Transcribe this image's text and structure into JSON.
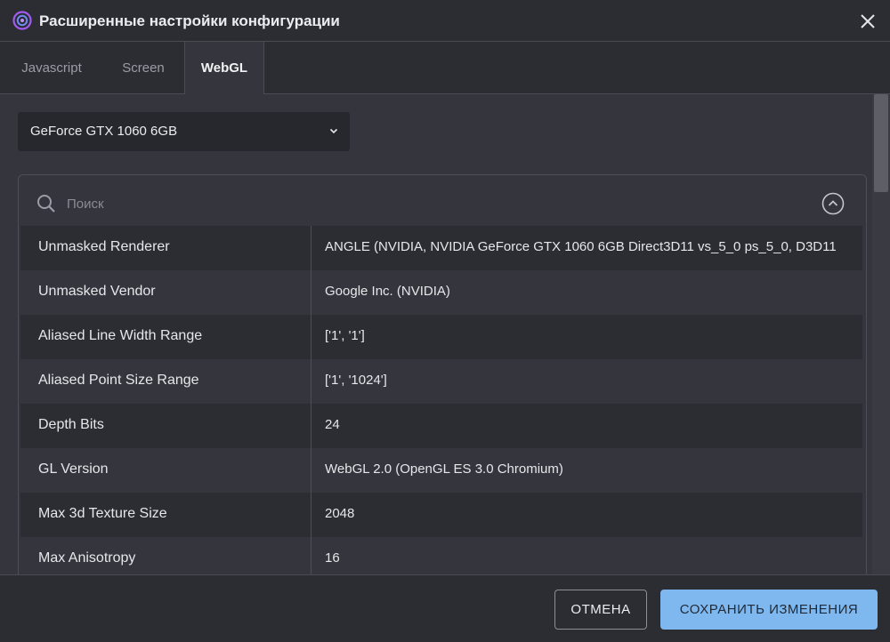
{
  "window": {
    "title": "Расширенные настройки конфигурации",
    "logo_icon": "app-logo-icon",
    "close_icon": "close-icon"
  },
  "tabs": [
    {
      "label": "Javascript",
      "active": false
    },
    {
      "label": "Screen",
      "active": false
    },
    {
      "label": "WebGL",
      "active": true
    }
  ],
  "gpu_select": {
    "value": "GeForce GTX 1060 6GB"
  },
  "search": {
    "placeholder": "Поиск",
    "value": ""
  },
  "table": {
    "rows": [
      {
        "key": "Unmasked Renderer",
        "value": "ANGLE (NVIDIA, NVIDIA GeForce GTX 1060 6GB Direct3D11 vs_5_0 ps_5_0, D3D11"
      },
      {
        "key": "Unmasked Vendor",
        "value": "Google Inc. (NVIDIA)"
      },
      {
        "key": "Aliased Line Width Range",
        "value": "['1', '1']"
      },
      {
        "key": "Aliased Point Size Range",
        "value": "['1', '1024']"
      },
      {
        "key": "Depth Bits",
        "value": "24"
      },
      {
        "key": "GL Version",
        "value": "WebGL 2.0 (OpenGL ES 3.0 Chromium)"
      },
      {
        "key": "Max 3d Texture Size",
        "value": "2048"
      },
      {
        "key": "Max Anisotropy",
        "value": "16"
      }
    ]
  },
  "footer": {
    "cancel_label": "ОТМЕНА",
    "save_label": "СОХРАНИТЬ ИЗМЕНЕНИЯ"
  },
  "colors": {
    "accent": "#7eb8ef",
    "background": "#2c2d33",
    "panel": "#35363d",
    "logo": "#a25bf0"
  }
}
